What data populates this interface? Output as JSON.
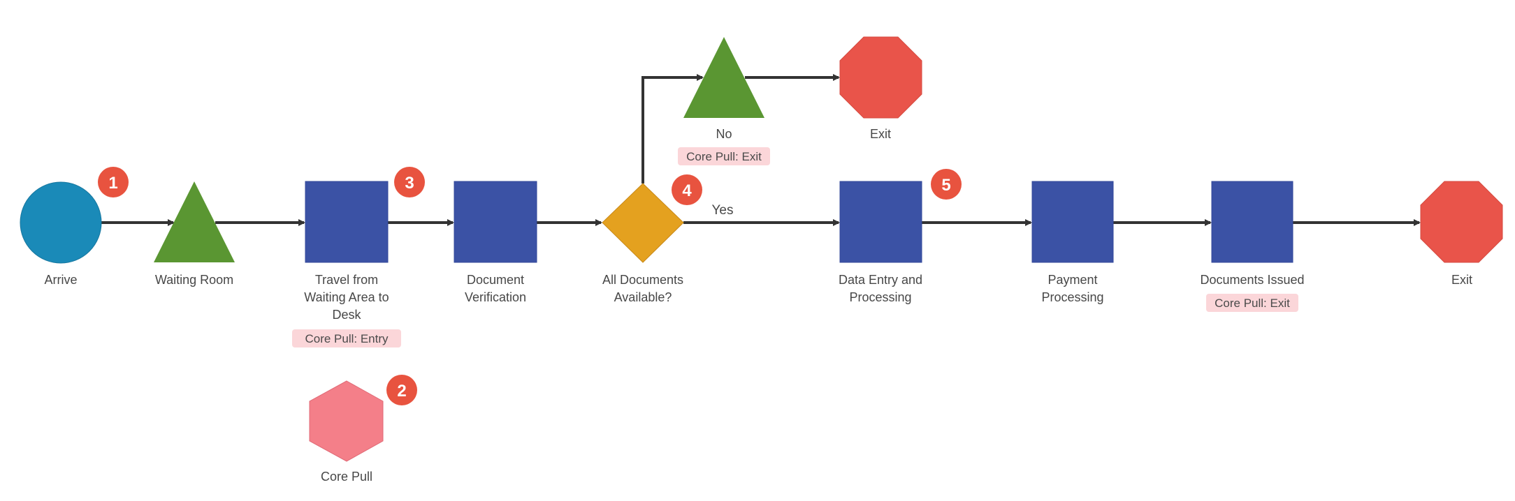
{
  "colors": {
    "start": "#1a8ab8",
    "wait": "#5a9632",
    "process": "#3b52a5",
    "decision": "#e4a11f",
    "exit": "#e9544a",
    "core_pull": "#f47f89",
    "badge": "#e8533f",
    "tag_bg": "#fbd6d9",
    "edge": "#333333"
  },
  "nodes": {
    "arrive": {
      "shape": "circle",
      "label": [
        "Arrive"
      ]
    },
    "waiting_room": {
      "shape": "triangle",
      "label": [
        "Waiting Room"
      ]
    },
    "travel": {
      "shape": "square",
      "label": [
        "Travel from",
        "Waiting Area to",
        "Desk"
      ],
      "tag": "Core Pull: Entry"
    },
    "doc_verification": {
      "shape": "square",
      "label": [
        "Document",
        "Verification"
      ]
    },
    "all_docs": {
      "shape": "diamond",
      "label": [
        "All Documents",
        "Available?"
      ]
    },
    "no": {
      "shape": "triangle",
      "label": [
        "No"
      ],
      "tag": "Core Pull: Exit"
    },
    "exit_top": {
      "shape": "octagon",
      "label": [
        "Exit"
      ]
    },
    "data_entry": {
      "shape": "square",
      "label": [
        "Data Entry and",
        "Processing"
      ]
    },
    "payment": {
      "shape": "square",
      "label": [
        "Payment",
        "Processing"
      ]
    },
    "docs_issued": {
      "shape": "square",
      "label": [
        "Documents Issued"
      ],
      "tag": "Core Pull: Exit"
    },
    "exit_end": {
      "shape": "octagon",
      "label": [
        "Exit"
      ]
    },
    "core_pull": {
      "shape": "hexagon",
      "label": [
        "Core Pull"
      ]
    }
  },
  "edges": {
    "yes_label": "Yes"
  },
  "badges": [
    "1",
    "2",
    "3",
    "4",
    "5"
  ]
}
